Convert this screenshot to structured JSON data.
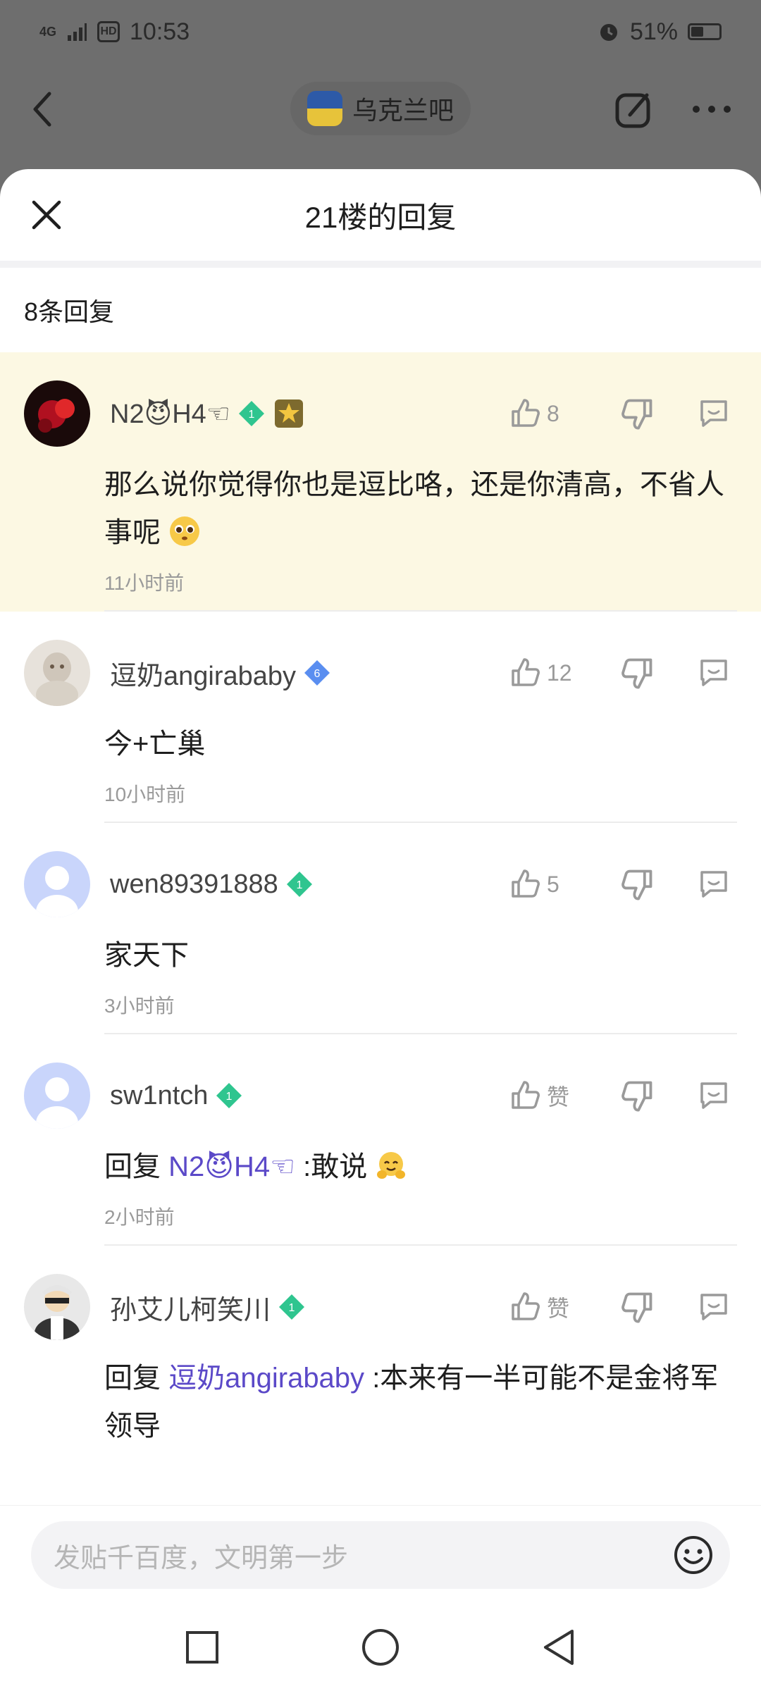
{
  "status_bar": {
    "network": "4G",
    "hd": "HD",
    "time": "10:53",
    "battery": "51%",
    "battery_level": 0.51
  },
  "background_nav": {
    "forum_name": "乌克兰吧"
  },
  "sheet": {
    "title": "21楼的回复",
    "reply_count": "8条回复"
  },
  "comments": [
    {
      "username": "N2😈H4☜",
      "level": "1",
      "likes": "8",
      "text": "那么说你觉得你也是逗比咯，还是你清高，不省人事呢",
      "time": "11小时前"
    },
    {
      "username": "逗奶angirababy",
      "level": "6",
      "likes": "12",
      "text": "今+亡巢",
      "time": "10小时前"
    },
    {
      "username": "wen89391888",
      "level": "1",
      "likes": "5",
      "text": "家天下",
      "time": "3小时前"
    },
    {
      "username": "sw1ntch",
      "level": "1",
      "likes": "赞",
      "reply_prefix": "回复 ",
      "mention": "N2😈H4☜",
      "text": ":敢说",
      "time": "2小时前"
    },
    {
      "username": "孙艾儿柯笑川",
      "level": "1",
      "likes": "赞",
      "reply_prefix": "回复 ",
      "mention": "逗奶angirababy",
      "text": ":本来有一半可能不是金将军领导"
    }
  ],
  "input": {
    "placeholder": "发贴千百度，文明第一步"
  },
  "colors": {
    "highlight_bg": "#fcf8e3",
    "mention": "#5b49c8",
    "level_green": "#2fc58f",
    "level_blue": "#5a8ef0"
  }
}
